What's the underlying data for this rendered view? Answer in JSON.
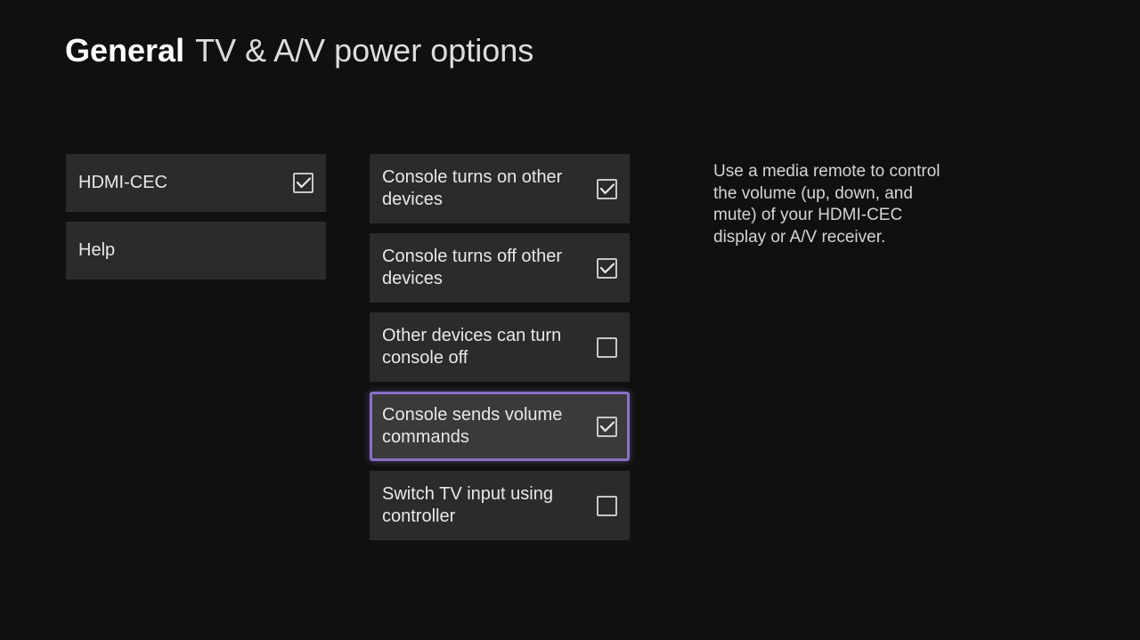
{
  "header": {
    "title_bold": "General",
    "title_light": "TV & A/V power options"
  },
  "left_items": [
    {
      "label": "HDMI-CEC",
      "checkbox": true,
      "checked": true
    },
    {
      "label": "Help",
      "checkbox": false
    }
  ],
  "mid_items": [
    {
      "label": "Console turns on other devices",
      "checked": true,
      "selected": false
    },
    {
      "label": "Console turns off other devices",
      "checked": true,
      "selected": false
    },
    {
      "label": "Other devices can turn console off",
      "checked": false,
      "selected": false
    },
    {
      "label": "Console sends volume commands",
      "checked": true,
      "selected": true
    },
    {
      "label": "Switch TV input using controller",
      "checked": false,
      "selected": false
    }
  ],
  "description": "Use a media remote to control the volume (up, down, and mute) of your HDMI-CEC display or A/V receiver."
}
